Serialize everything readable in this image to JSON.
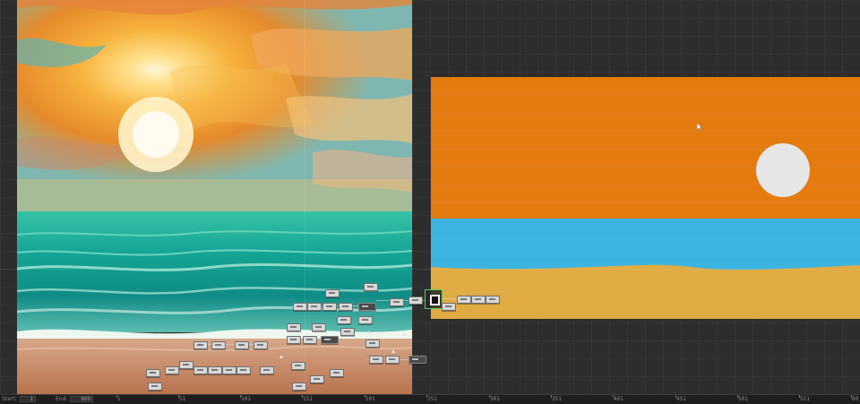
{
  "timeline": {
    "start_label": "Start:",
    "start_value": "1",
    "end_label": "End:",
    "end_value": "600",
    "ticks": [
      "1",
      "51",
      "101",
      "151",
      "201",
      "251",
      "301",
      "351",
      "401",
      "451",
      "501",
      "551",
      "60"
    ]
  },
  "colors": {
    "sky_orange": "#e37b0f",
    "sea_blue": "#3db4e0",
    "sand": "#e0ab42",
    "sun": "#e6e6e6",
    "selection_green": "#55d15b"
  },
  "icons": {
    "cursor": "cursor-arrow-icon",
    "node": "node-box-icon"
  }
}
